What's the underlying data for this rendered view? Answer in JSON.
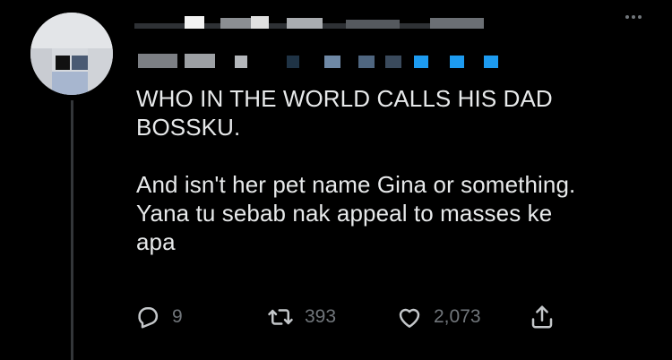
{
  "tweet": {
    "paragraphs": [
      "WHO IN THE WORLD CALLS HIS DAD",
      "BOSSKU.",
      "And isn't her pet name Gina or something.",
      "Yana tu sebab nak appeal to masses ke",
      "apa"
    ],
    "actions": {
      "reply_count": "9",
      "retweet_count": "393",
      "like_count": "2,073"
    },
    "icons": {
      "more": "more-horizontal-icon",
      "reply": "reply-icon",
      "retweet": "retweet-icon",
      "like": "heart-icon",
      "share": "share-icon"
    }
  },
  "colors": {
    "background": "#000000",
    "text": "#e7e9ea",
    "muted": "#71767b",
    "accent_redacted": "#1d9bf0"
  }
}
